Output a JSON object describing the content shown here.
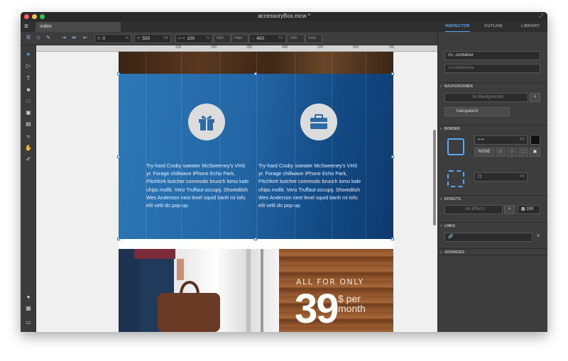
{
  "window": {
    "title": "accessoryBox.mcw *",
    "doc_tab": "index",
    "colors": {
      "close": "#fc605b",
      "minimize": "#fdbc40",
      "maximize": "#34c84a",
      "accent": "#5aa7ff"
    }
  },
  "inspector_tabs": [
    {
      "label": "INSPECTOR",
      "active": true
    },
    {
      "label": "OUTLINE",
      "active": false
    },
    {
      "label": "LIBRARY",
      "active": false
    }
  ],
  "toolbar": {
    "x_label": "X",
    "x_value": "0",
    "x_unit": "%",
    "y_label": "Y",
    "y_value": "550",
    "y_unit": "PX",
    "width_value": "100",
    "width_unit": "%",
    "width_min": "min",
    "width_max": "max",
    "height_value": "450",
    "height_unit": "PX",
    "height_min": "min",
    "height_max": "max"
  },
  "ruler": {
    "labels": [
      "100",
      "200",
      "300",
      "400",
      "500",
      "600",
      "700"
    ]
  },
  "canvas": {
    "text_col1": "Try-hard Cosby sweater McSweeney's VHS yr. Forage chillwave iPhone Echo Park, Pitchfork butcher commodo brunch lomo kale chips mollit. Vero Truffaut occupy, Shoreditch Wes Anderson next level squid banh mi tofu elit velit do pop-up.",
    "text_col2": "Try-hard Cosby sweater McSweeney's VHS yr. Forage chillwave iPhone Echo Park, Pitchfork butcher commodo brunch lomo kale chips mollit. Vero Truffaut occupy, Shoreditch Wes Anderson next level squid banh mi tofu elit velit do pop-up.",
    "icon1": "gift-icon",
    "icon2": "briefcase-icon",
    "promo_top": "ALL FOR ONLY",
    "promo_price": "39",
    "promo_per": "$ per",
    "promo_month": "month"
  },
  "inspector": {
    "element_tag": "div",
    "element_class": ".container",
    "variable_placeholder": "variableName",
    "backgrounds_title": "BACKGROUNDS",
    "no_backgrounds": "No Backgrounds",
    "add_bg": "+",
    "bg_color_label": "transparent",
    "border_title": "BORDER",
    "border_unit": "PX",
    "border_style_none": "NONE",
    "radius_unit": "PX",
    "effects_title": "EFFECTS",
    "no_effects": "No Effects",
    "add_effect": "+",
    "opacity": "100",
    "links_title": "LINKS",
    "advanced_title": "ADVANCED"
  }
}
